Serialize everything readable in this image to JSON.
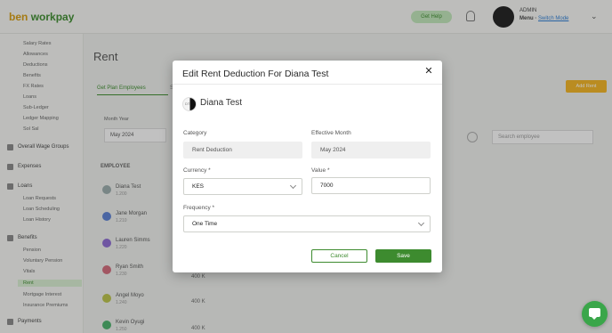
{
  "app": {
    "logo_text": "ben",
    "logo_text2": "workpay",
    "upgrade_label": "Get Help",
    "user_name": "ADMIN",
    "user_org_prefix": "Menu ·",
    "user_org_link": "Switch Mode",
    "page_title": "Rent",
    "tab_active": "Get Plan Employees",
    "tab_2": "S",
    "add_button": "Add Rent",
    "month_label": "Month Year",
    "month_value": "May 2024",
    "search_placeholder": "Search employee",
    "employees_header": "EMPLOYEE",
    "row_values": [
      "400 K",
      "400 K",
      "400 K"
    ]
  },
  "sidebar": {
    "items": [
      "Salary Rates",
      "Allowances",
      "Deductions",
      "Benefits",
      "FX Rates",
      "Loans",
      "Sub-Ledger",
      "Ledger Mapping"
    ],
    "section_1": "Sol Sal",
    "section_2": "Overall Wage Groups",
    "section_3": "Expenses",
    "section_4": "Loans",
    "loan_items": [
      "Loan Requests",
      "Loan Scheduling",
      "Loan History"
    ],
    "section_5": "Benefits",
    "benefit_items": [
      "Pension",
      "Voluntary Pension",
      "Vitals",
      "Rent",
      "Mortgage Interest",
      "Insurance Premiums"
    ],
    "section_6": "Payments"
  },
  "employees": [
    {
      "name": "Diana Test",
      "sub": "1.200"
    },
    {
      "name": "Jane Morgan",
      "sub": "1.210"
    },
    {
      "name": "Lauren Simms",
      "sub": "1.220"
    },
    {
      "name": "Ryan Smith",
      "sub": "1.230"
    },
    {
      "name": "Angel Moyo",
      "sub": "1.240"
    },
    {
      "name": "Kevin Oyugi",
      "sub": "1.250"
    }
  ],
  "modal": {
    "title": "Edit Rent Deduction For Diana Test",
    "avatar_initials": "DT",
    "employee_name": "Diana Test",
    "category": {
      "label": "Category",
      "value": "Rent Deduction"
    },
    "effective_month": {
      "label": "Effective Month",
      "value": "May 2024"
    },
    "currency": {
      "label": "Currency *",
      "value": "KES"
    },
    "value": {
      "label": "Value *",
      "value": "7000"
    },
    "frequency": {
      "label": "Frequency *",
      "value": "One Time"
    },
    "cancel_label": "Cancel",
    "save_label": "Save"
  },
  "colors": {
    "accent_green": "#3d8b2f",
    "amber": "#f0b323",
    "chat_green": "#3aa64a"
  },
  "icons": [
    "close-icon",
    "chevron-down-icon",
    "chat-icon",
    "bell-icon",
    "search-icon"
  ]
}
